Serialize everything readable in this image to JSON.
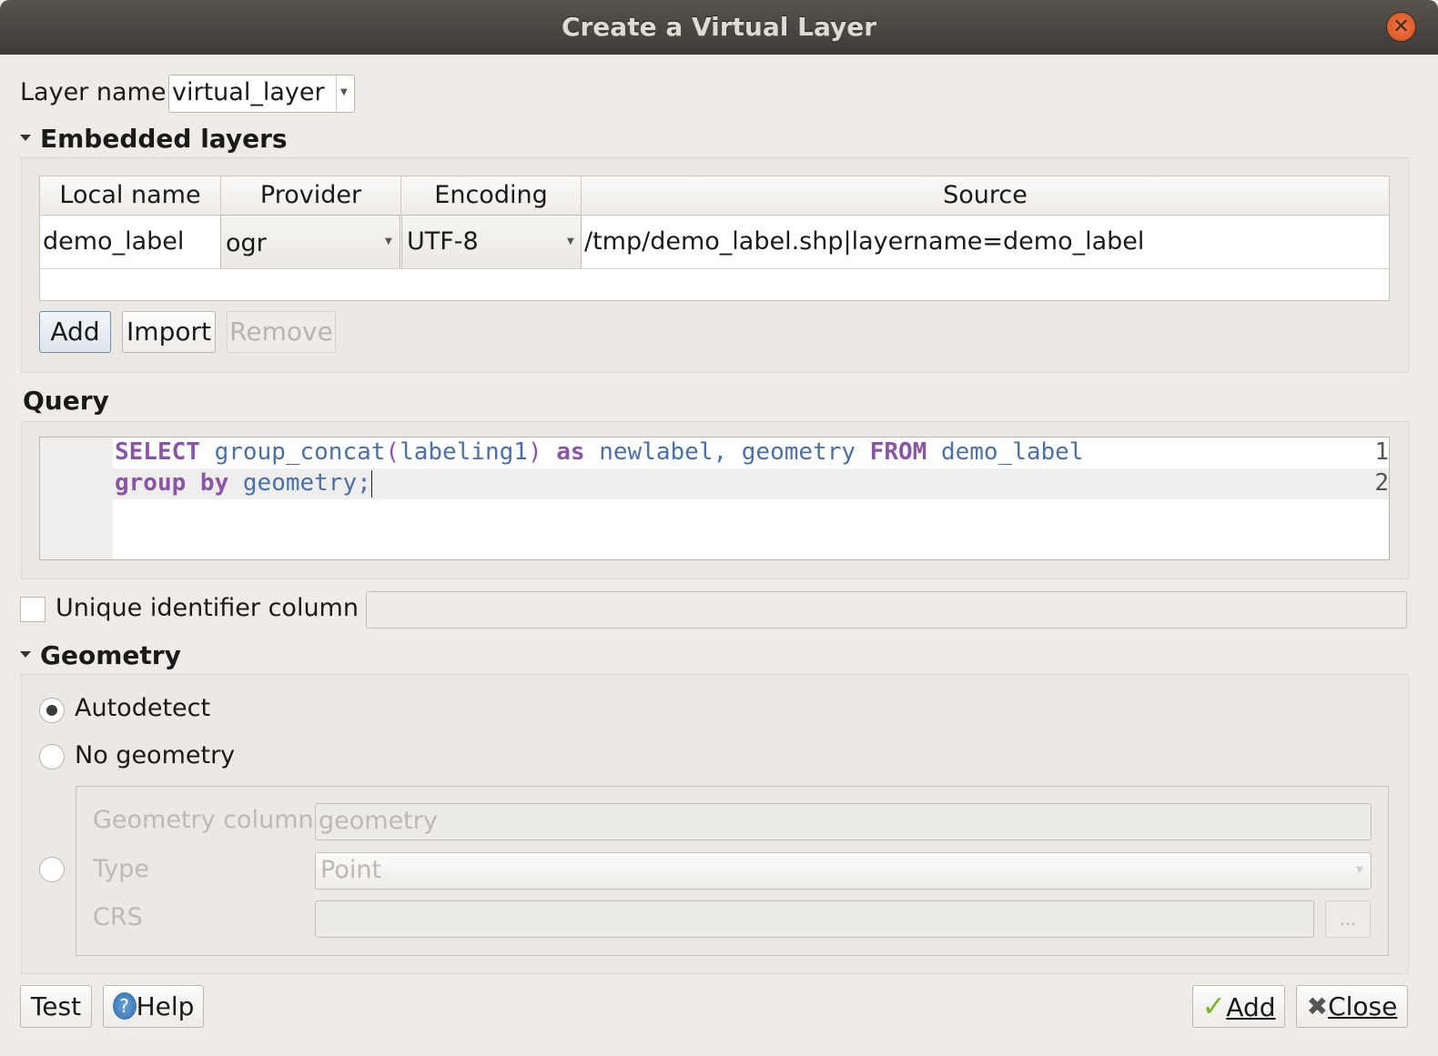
{
  "window": {
    "title": "Create a Virtual Layer",
    "close_icon": "close-icon"
  },
  "layer_name": {
    "label": "Layer name",
    "value": "virtual_layer"
  },
  "embedded": {
    "heading": "Embedded layers",
    "columns": [
      "Local name",
      "Provider",
      "Encoding",
      "Source"
    ],
    "rows": [
      {
        "local_name": "demo_label",
        "provider": "ogr",
        "encoding": "UTF-8",
        "source": "/tmp/demo_label.shp|layername=demo_label"
      }
    ],
    "buttons": {
      "add": "Add",
      "import": "Import",
      "remove": "Remove"
    }
  },
  "query": {
    "heading": "Query",
    "line_numbers": [
      "1",
      "2"
    ],
    "lines": [
      [
        {
          "t": "SELECT",
          "c": "kw"
        },
        {
          "t": " ",
          "c": ""
        },
        {
          "t": "group_concat",
          "c": "id"
        },
        {
          "t": "(",
          "c": "pn"
        },
        {
          "t": "labeling1",
          "c": "id"
        },
        {
          "t": ")",
          "c": "pn"
        },
        {
          "t": " ",
          "c": ""
        },
        {
          "t": "as",
          "c": "kw"
        },
        {
          "t": " newlabel, geometry ",
          "c": "id"
        },
        {
          "t": "FROM",
          "c": "kw"
        },
        {
          "t": " demo_label",
          "c": "id"
        }
      ],
      [
        {
          "t": "group by",
          "c": "kw"
        },
        {
          "t": " geometry;",
          "c": "id"
        }
      ]
    ]
  },
  "unique_id": {
    "label": "Unique identifier column",
    "checked": false,
    "value": ""
  },
  "geometry": {
    "heading": "Geometry",
    "options": {
      "autodetect": "Autodetect",
      "no_geometry": "No geometry"
    },
    "selected": "autodetect",
    "column_label": "Geometry column",
    "column_value": "geometry",
    "type_label": "Type",
    "type_value": "Point",
    "crs_label": "CRS",
    "crs_value": "",
    "crs_button": "..."
  },
  "footer": {
    "test": "Test",
    "help": "Help",
    "add": "Add",
    "close": "Close"
  }
}
